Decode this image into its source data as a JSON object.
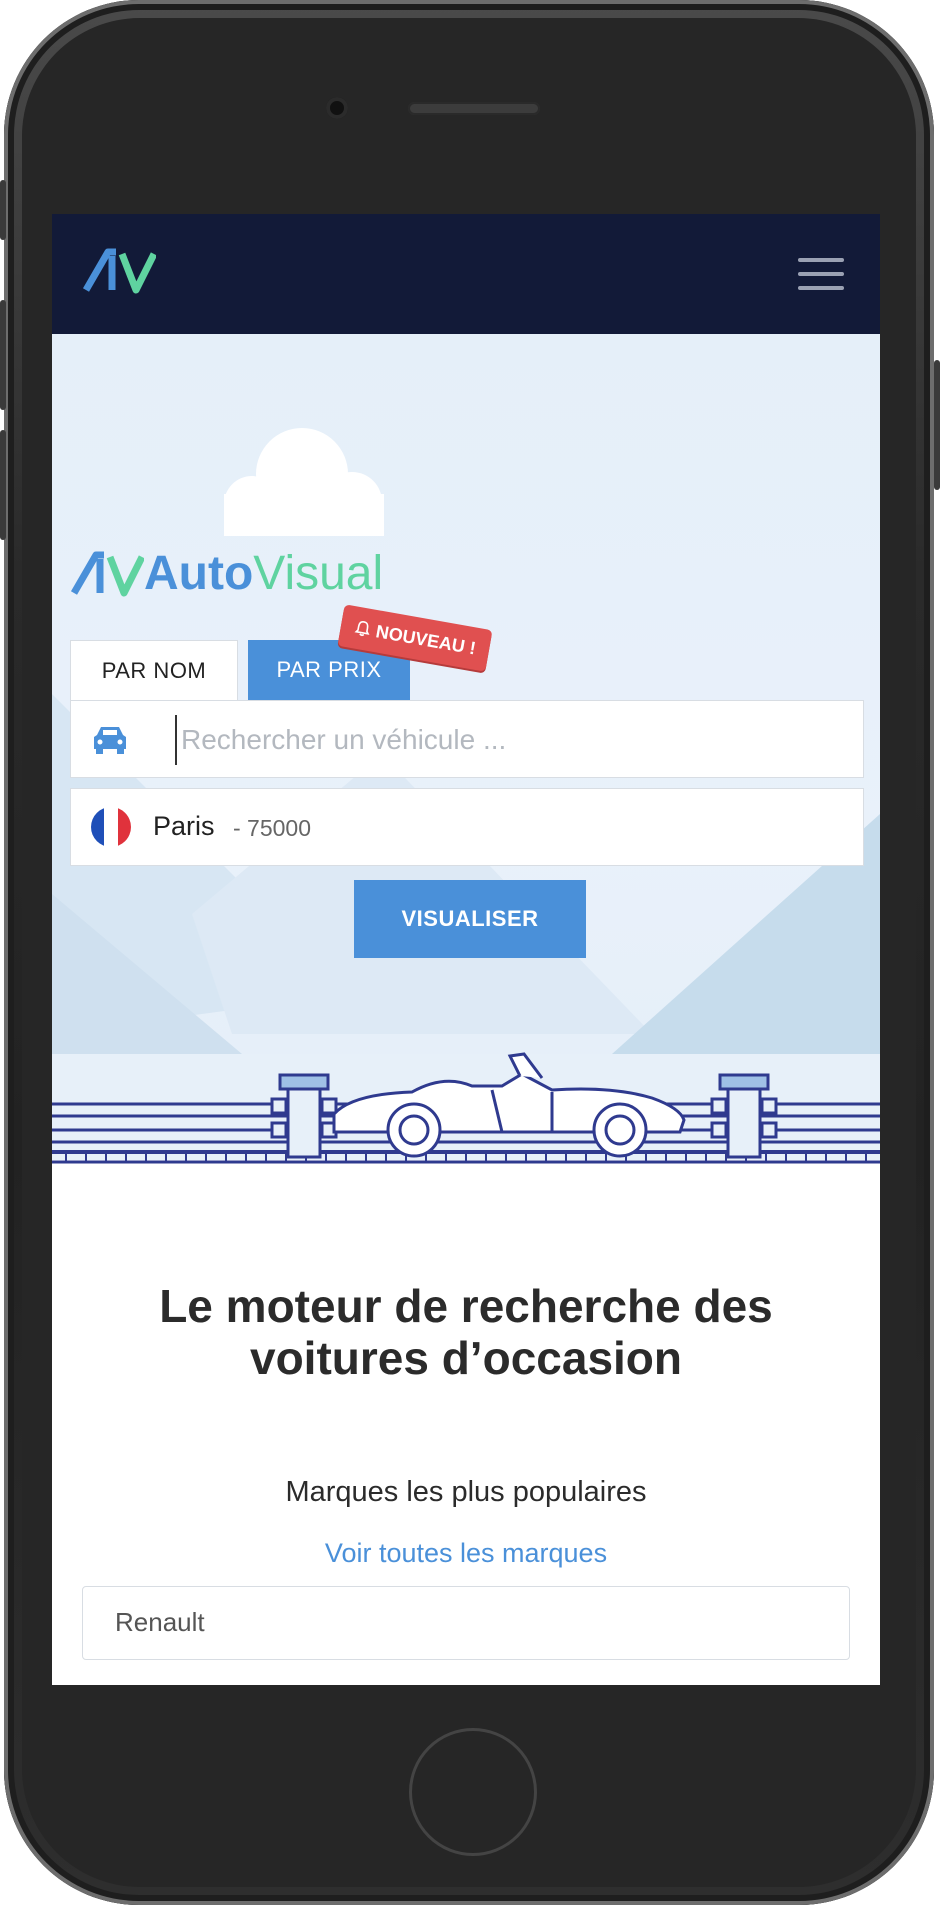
{
  "header": {
    "logo_icon": "autovisual-av-logo",
    "menu_icon": "hamburger-icon"
  },
  "hero": {
    "brand_part1": "Auto",
    "brand_part2": "Visual",
    "new_badge": "NOUVEAU !",
    "tabs": [
      {
        "label": "PAR NOM",
        "active": true
      },
      {
        "label": "PAR PRIX",
        "active": false
      }
    ],
    "search": {
      "placeholder": "Rechercher un véhicule ...",
      "value": ""
    },
    "location": {
      "city": "Paris",
      "zip": "- 75000",
      "flag_colors": [
        "#1f4fb8",
        "#ffffff",
        "#e0323c"
      ]
    },
    "submit_label": "VISUALISER"
  },
  "main": {
    "title_line1": "Le moteur de recherche des",
    "title_line2": "voitures d’occasion",
    "subtitle": "Marques les plus populaires",
    "see_all_link": "Voir toutes les marques",
    "brand_select_value": "Renault"
  },
  "colors": {
    "navbar": "#121a38",
    "accent_blue": "#4a90d9",
    "accent_green": "#5fd3a0",
    "badge_red": "#e05050"
  }
}
